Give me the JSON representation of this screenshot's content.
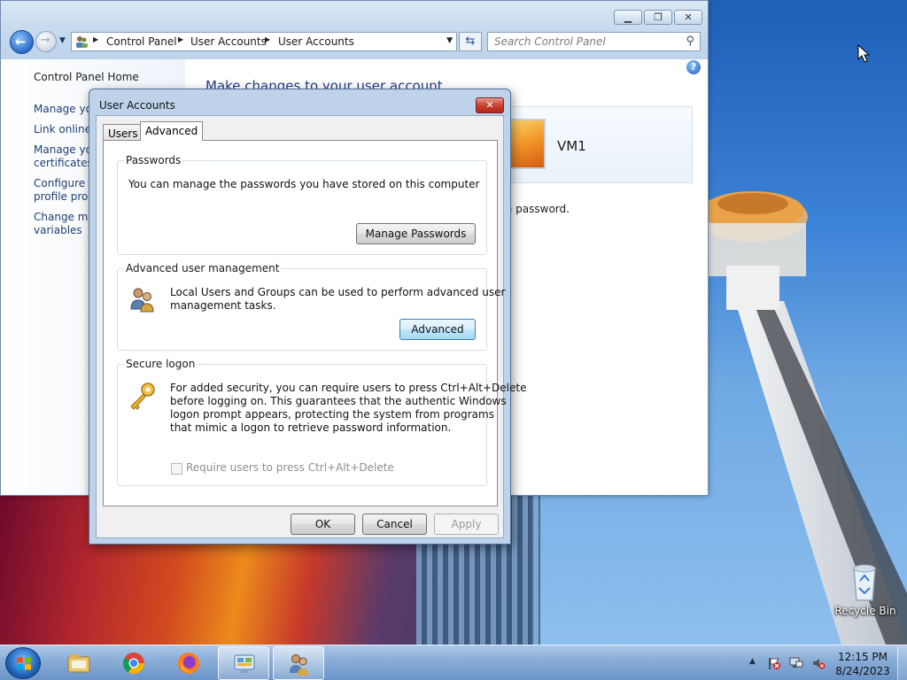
{
  "control_panel": {
    "address": {
      "segments": [
        "Control Panel",
        "User Accounts",
        "User Accounts"
      ]
    },
    "search": {
      "placeholder": "Search Control Panel"
    },
    "left_nav": {
      "home": "Control Panel Home",
      "links": [
        "Manage your credentials",
        "Link online IDs",
        "Manage your file encryption certificates",
        "Configure advanced user profile properties",
        "Change my environment variables"
      ],
      "visible_lines": [
        "Manage you",
        "Link online I",
        "Manage you",
        "certificates",
        "Configure a",
        "profile prop",
        "Change my",
        "variables"
      ]
    },
    "heading": "Make changes to your user account",
    "user_name": "VM1",
    "password_text_fragment": "a password."
  },
  "dialog": {
    "title": "User Accounts",
    "tabs": [
      "Users",
      "Advanced"
    ],
    "active_tab": "Advanced",
    "passwords": {
      "label": "Passwords",
      "text": "You can manage the passwords you have stored on this computer",
      "button": "Manage Passwords"
    },
    "advanced_mgmt": {
      "label": "Advanced user management",
      "text_line1": "Local Users and Groups can be used to perform advanced user",
      "text_line2": "management tasks.",
      "button": "Advanced"
    },
    "secure_logon": {
      "label": "Secure logon",
      "lines": [
        "For added security, you can require users to press Ctrl+Alt+Delete",
        "before logging on. This guarantees that the authentic Windows",
        "logon prompt appears, protecting the system from programs",
        "that mimic a logon to retrieve password information."
      ],
      "checkbox_label": "Require users to press Ctrl+Alt+Delete",
      "checkbox_checked": false
    },
    "buttons": {
      "ok": "OK",
      "cancel": "Cancel",
      "apply": "Apply"
    }
  },
  "desktop": {
    "recycle_bin_label": "Recycle Bin"
  },
  "taskbar": {
    "pinned": [
      "start-orb",
      "windows-explorer",
      "google-chrome",
      "firefox",
      "control-panel",
      "user-accounts"
    ],
    "clock_time": "12:15 PM",
    "clock_date": "8/24/2023",
    "tray_icons": [
      "action-center-flag",
      "network",
      "volume-muted"
    ]
  },
  "colors": {
    "link": "#1e3f74",
    "heading": "#1f3c88",
    "focus_button": "#3c7fb1",
    "close_red": "#c7412f"
  }
}
